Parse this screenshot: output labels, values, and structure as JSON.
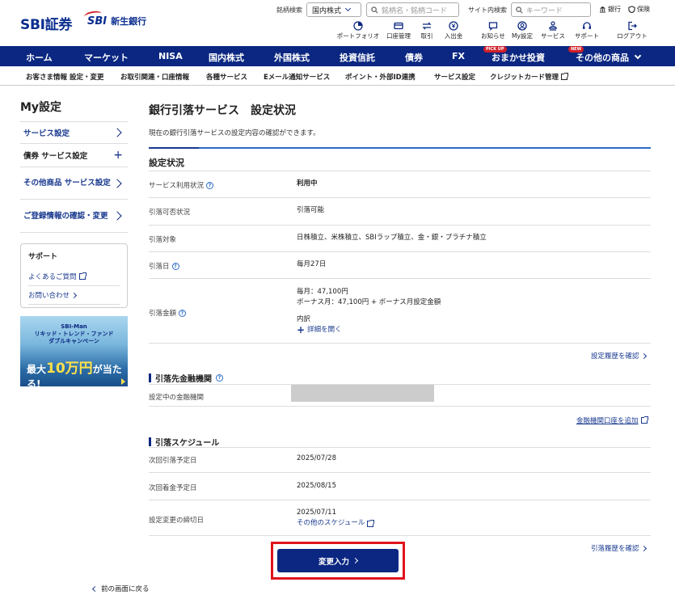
{
  "header": {
    "logo_text": "SBI証券",
    "bank_logo_text": "SBI",
    "bank_name": "新生銀行",
    "stock_search_label": "銘柄検索",
    "stock_search_select": "国内株式",
    "stock_search_placeholder": "銘柄名・銘柄コード",
    "site_search_label": "サイト内検索",
    "site_search_placeholder": "キーワード",
    "bank_link": "銀行",
    "insurance_link": "保険",
    "icons": [
      {
        "label": "ポートフォリオ"
      },
      {
        "label": "口座管理"
      },
      {
        "label": "取引"
      },
      {
        "label": "入出金"
      },
      {
        "label": "お知らせ"
      },
      {
        "label": "My設定"
      },
      {
        "label": "サービス"
      },
      {
        "label": "サポート"
      },
      {
        "label": "ログアウト"
      }
    ]
  },
  "main_nav": {
    "items": [
      "ホーム",
      "マーケット",
      "NISA",
      "国内株式",
      "外国株式",
      "投資信託",
      "債券",
      "FX",
      "おまかせ投資",
      "その他の商品"
    ],
    "pickup_badge": "PICK UP",
    "new_badge": "NEW"
  },
  "sub_nav": {
    "items": [
      "お客さま情報 設定・変更",
      "お取引関連・口座情報",
      "各種サービス",
      "Eメール通知サービス",
      "ポイント・外部ID連携",
      "サービス設定",
      "クレジットカード管理"
    ]
  },
  "sidebar": {
    "title": "My設定",
    "items": [
      {
        "label": "サービス設定"
      },
      {
        "label": "債券 サービス設定"
      },
      {
        "label": "その他商品 サービス設定"
      },
      {
        "label": "ご登録情報の確認・変更"
      }
    ],
    "support": {
      "title": "サポート",
      "links": [
        "よくあるご質問",
        "お問い合わせ"
      ]
    },
    "banner": {
      "line1": "SBI-Man",
      "line2": "リキッド・トレンド・ファンド",
      "line3": "ダブルキャンペーン",
      "prefix": "最大",
      "amount": "10万円",
      "suffix": "が当たる!"
    }
  },
  "content": {
    "title": "銀行引落サービス　設定状況",
    "description": "現在の銀行引落サービスの設定内容の確認ができます。",
    "section_title": "設定状況",
    "rows": [
      {
        "label": "サービス利用状況",
        "value": "利用中"
      },
      {
        "label": "引落可否状況",
        "value": "引落可能"
      },
      {
        "label": "引落対象",
        "value": "日株積立、米株積立、SBIラップ積立、金・銀・プラチナ積立"
      },
      {
        "label": "引落日",
        "value": "毎月27日"
      },
      {
        "label": "引落金額",
        "value_line1": "毎月：47,100円",
        "value_line2": "ボーナス月：47,100円 + ボーナス月設定金額",
        "value_line3": "内訳",
        "detail_link": "詳細を開く"
      }
    ],
    "history_link": "設定履歴を確認",
    "bank_section": {
      "title": "引落先金融機関",
      "label": "設定中の金融機関",
      "add_link": "金融機関口座を追加"
    },
    "schedule_section": {
      "title": "引落スケジュール",
      "rows": [
        {
          "label": "次回引落予定日",
          "value": "2025/07/28"
        },
        {
          "label": "次回着金予定日",
          "value": "2025/08/15"
        },
        {
          "label": "設定変更の締切日",
          "value": "2025/07/11",
          "link": "その他のスケジュール"
        }
      ],
      "history_link": "引落履歴を確認"
    },
    "change_button": "変更入力",
    "back_link": "前の画面に戻る"
  }
}
